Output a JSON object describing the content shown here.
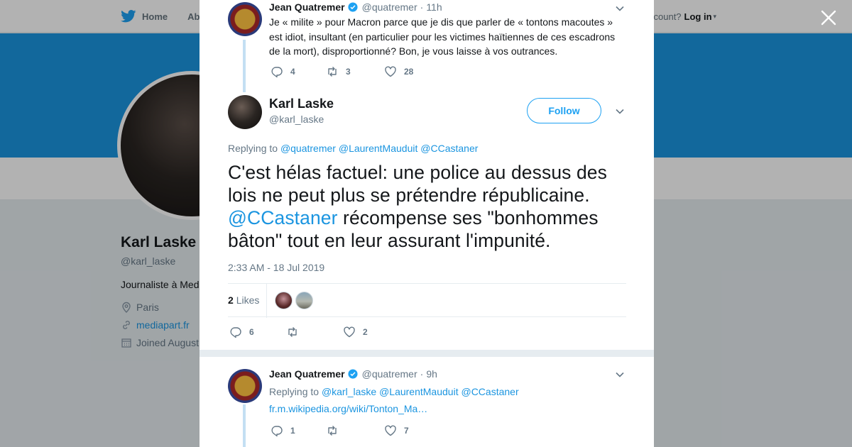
{
  "background": {
    "nav": {
      "home_label": "Home",
      "about_label": "Abo"
    },
    "login": {
      "prompt": "ccount?",
      "login_label": "Log in"
    },
    "profile": {
      "name": "Karl Laske",
      "handle": "@karl_laske",
      "bio": "Journaliste à Med",
      "location": "Paris",
      "website": "mediapart.fr",
      "joined": "Joined August"
    }
  },
  "modal": {
    "parent_tweet": {
      "author_name": "Jean Quatremer",
      "handle": "@quatremer",
      "time": "11h",
      "text": "Je « milite » pour Macron parce que je dis que parler de « tontons macoutes » est idiot, insultant (en particulier pour les victimes haïtiennes de ces escadrons de la mort), disproportionné? Bon, je vous laisse à vos outrances.",
      "replies": "4",
      "retweets": "3",
      "likes": "28"
    },
    "main_tweet": {
      "author_name": "Karl Laske",
      "handle": "@karl_laske",
      "follow_label": "Follow",
      "replying_prefix": "Replying to",
      "replying_to": [
        "@quatremer",
        "@LaurentMauduit",
        "@CCastaner"
      ],
      "text_part1": "C'est hélas factuel: une police au dessus des lois ne peut plus se prétendre républicaine.",
      "text_mention": "@CCastaner",
      "text_part2": " récompense ses \"bonhommes bâton\" tout en leur assurant l'impunité.",
      "timestamp": "2:33 AM - 18 Jul 2019",
      "likes_count": "2",
      "likes_label": "Likes",
      "replies": "6",
      "retweets": "",
      "likes": "2"
    },
    "reply_tweet": {
      "author_name": "Jean Quatremer",
      "handle": "@quatremer",
      "time": "9h",
      "replying_prefix": "Replying to",
      "replying_to": [
        "@karl_laske",
        "@LaurentMauduit",
        "@CCastaner"
      ],
      "link": "fr.m.wikipedia.org/wiki/Tonton_Ma…",
      "replies": "1",
      "retweets": "",
      "likes": "7"
    }
  },
  "colors": {
    "accent": "#1da1f2",
    "link": "#1b95e0",
    "banner": "#1b95e0",
    "thread_line": "#c4dff3"
  },
  "icons": [
    "twitter-bird-icon",
    "close-icon",
    "verified-icon",
    "chevron-down-icon",
    "reply-icon",
    "retweet-icon",
    "heart-icon",
    "location-icon",
    "link-icon",
    "calendar-icon"
  ]
}
